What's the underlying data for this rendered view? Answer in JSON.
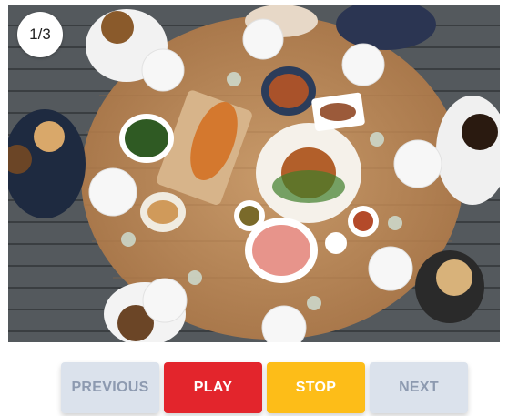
{
  "slideshow": {
    "counter": "1/3",
    "image_alt": "Overhead view of people sharing a meal around a round wooden table",
    "buttons": {
      "previous": "PREVIOUS",
      "play": "PLAY",
      "stop": "STOP",
      "next": "NEXT"
    }
  },
  "colors": {
    "previous_bg": "#dbe2ec",
    "play_bg": "#e3252c",
    "stop_bg": "#fdbd18",
    "next_bg": "#dbe2ec"
  }
}
